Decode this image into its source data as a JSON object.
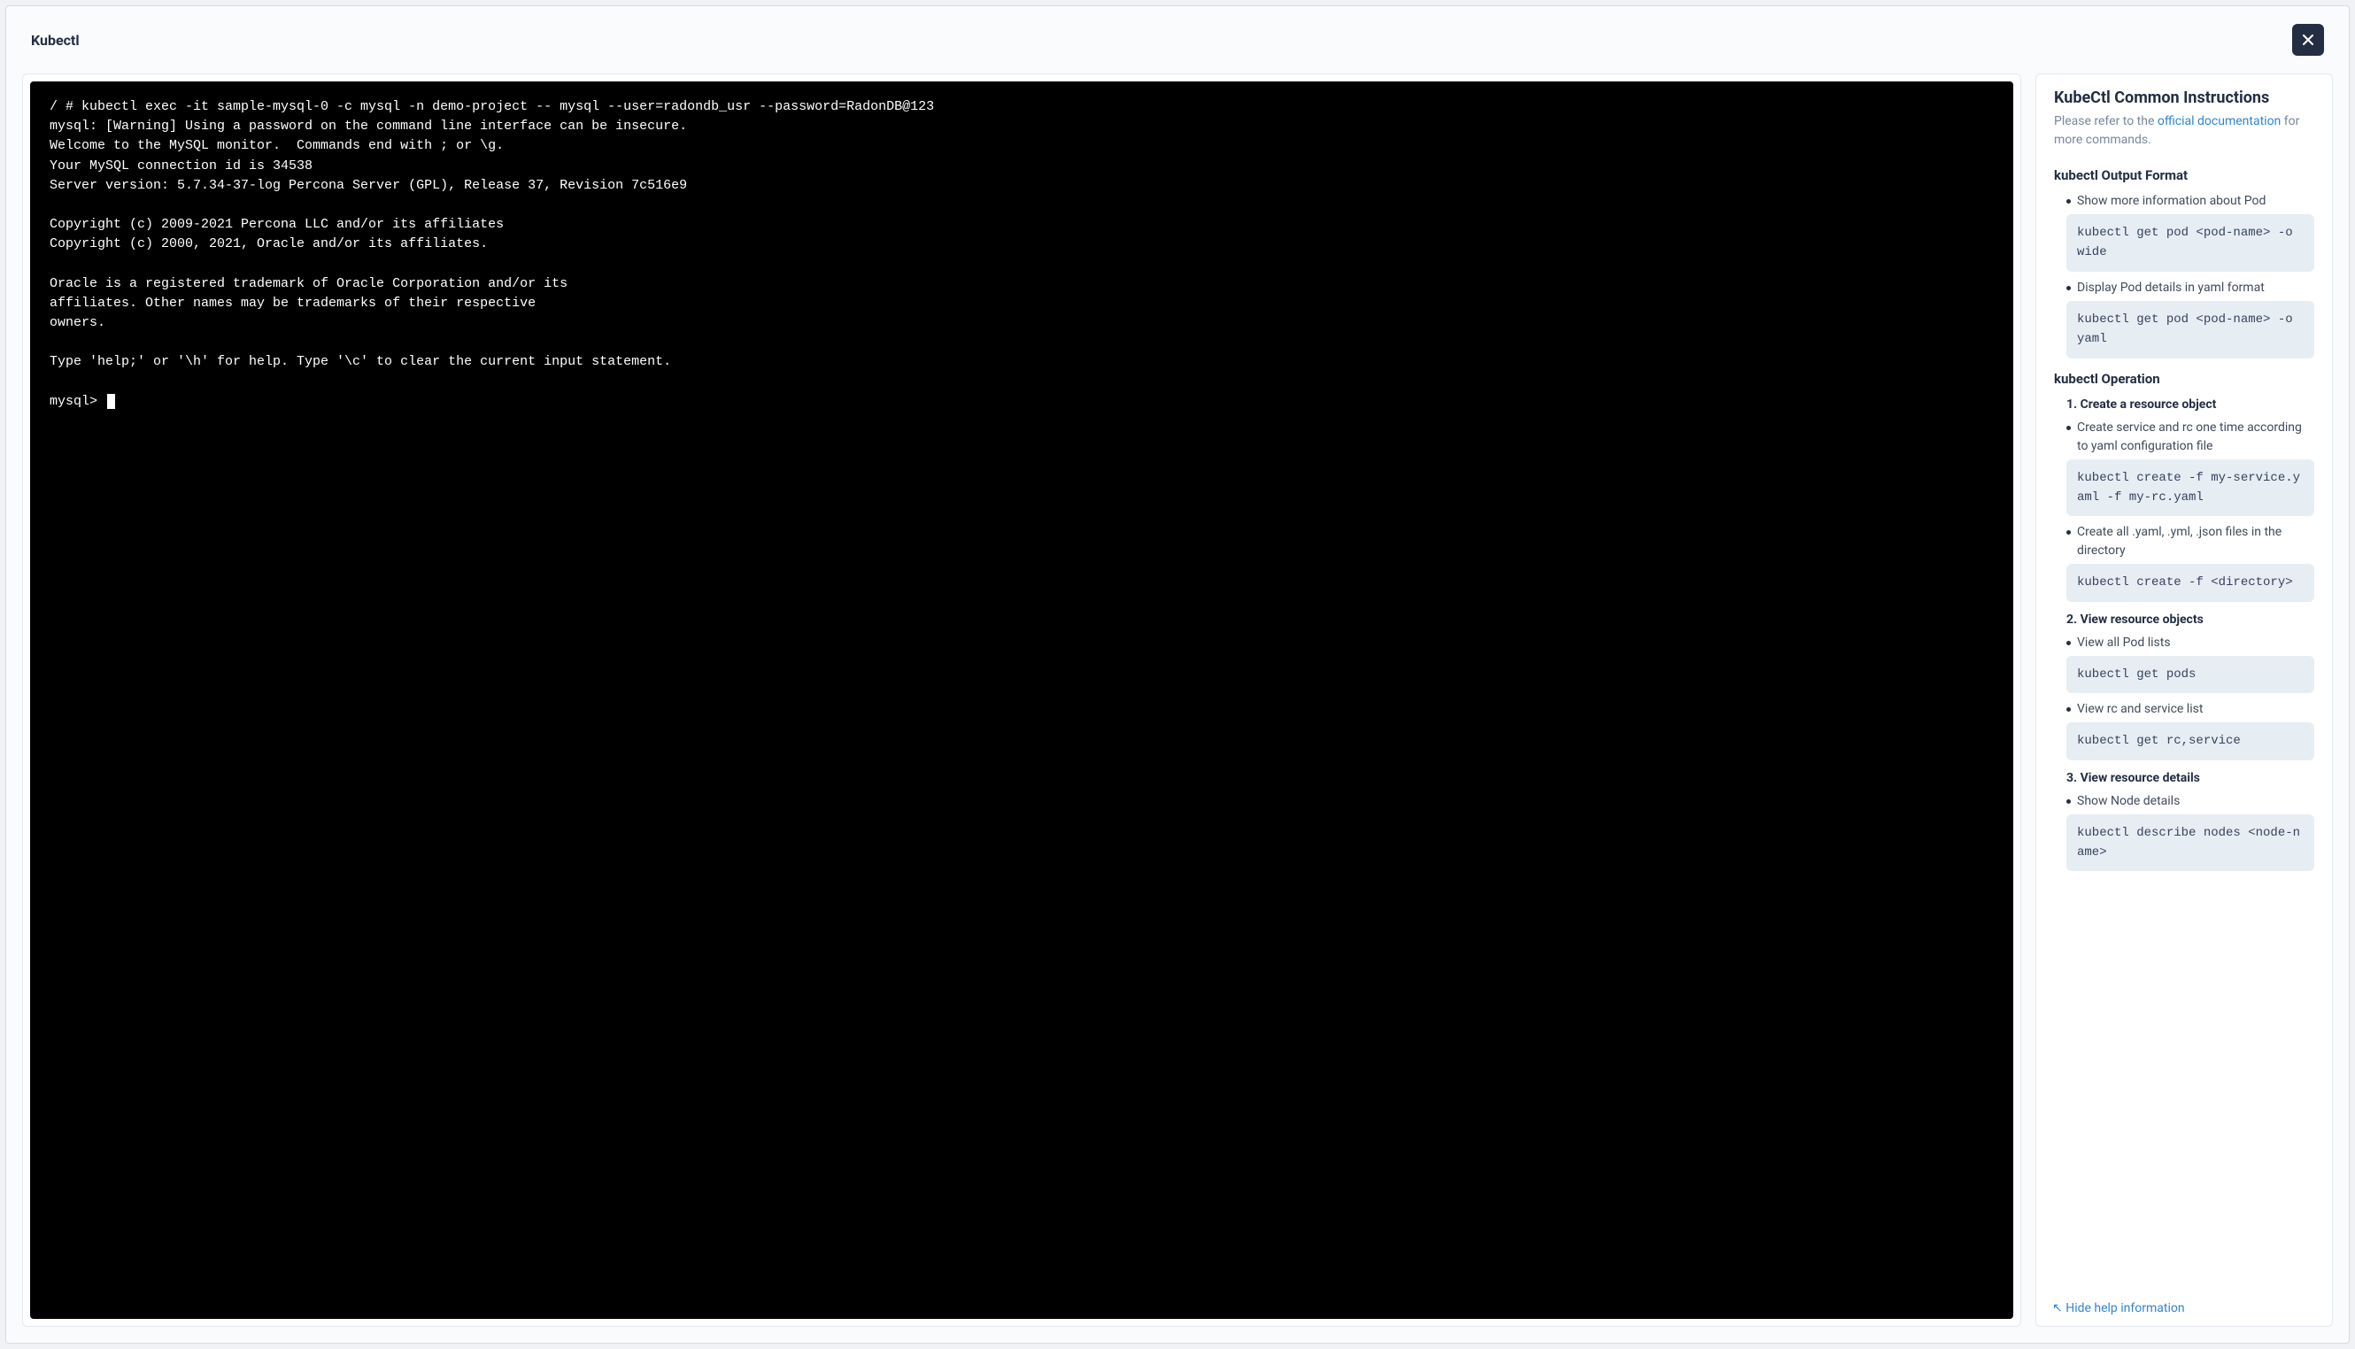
{
  "header": {
    "title": "Kubectl"
  },
  "terminal": {
    "content": "/ # kubectl exec -it sample-mysql-0 -c mysql -n demo-project -- mysql --user=radondb_usr --password=RadonDB@123\nmysql: [Warning] Using a password on the command line interface can be insecure.\nWelcome to the MySQL monitor.  Commands end with ; or \\g.\nYour MySQL connection id is 34538\nServer version: 5.7.34-37-log Percona Server (GPL), Release 37, Revision 7c516e9\n\nCopyright (c) 2009-2021 Percona LLC and/or its affiliates\nCopyright (c) 2000, 2021, Oracle and/or its affiliates.\n\nOracle is a registered trademark of Oracle Corporation and/or its\naffiliates. Other names may be trademarks of their respective\nowners.\n\nType 'help;' or '\\h' for help. Type '\\c' to clear the current input statement.\n\nmysql> "
  },
  "help": {
    "title": "KubeCtl Common Instructions",
    "subtitle_prefix": "Please refer to the ",
    "subtitle_link": "official documentation",
    "subtitle_suffix": " for more commands.",
    "hide_label": "↖ Hide help information",
    "sections": [
      {
        "heading": "kubectl Output Format",
        "items": [
          {
            "desc": "Show more information about Pod",
            "code": "kubectl get pod <pod-name> -o wide"
          },
          {
            "desc": "Display Pod details in yaml format",
            "code": "kubectl get pod <pod-name> -o yaml"
          }
        ]
      },
      {
        "heading": "kubectl Operation",
        "subsections": [
          {
            "subheading": "1. Create a resource object",
            "items": [
              {
                "desc": "Create service and rc one time according to yaml configuration file",
                "code": "kubectl create -f my-service.yaml -f my-rc.yaml"
              },
              {
                "desc": "Create all .yaml, .yml, .json files in the directory",
                "code": "kubectl create -f <directory>"
              }
            ]
          },
          {
            "subheading": "2. View resource objects",
            "items": [
              {
                "desc": "View all Pod lists",
                "code": "kubectl get pods"
              },
              {
                "desc": "View rc and service list",
                "code": "kubectl get rc,service"
              }
            ]
          },
          {
            "subheading": "3. View resource details",
            "items": [
              {
                "desc": "Show Node details",
                "code": "kubectl describe nodes <node-name>"
              }
            ]
          }
        ]
      }
    ]
  }
}
